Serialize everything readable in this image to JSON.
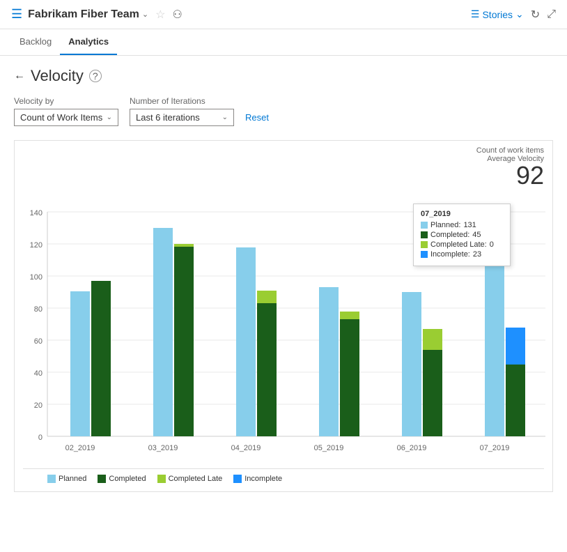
{
  "header": {
    "icon": "☰",
    "team_name": "Fabrikam Fiber Team",
    "chevron": "⌄",
    "star": "☆",
    "people": "⚇",
    "stories_label": "Stories",
    "stories_chevron": "⌄",
    "refresh": "↻",
    "expand": "⤢"
  },
  "tabs": [
    {
      "label": "Backlog",
      "active": false
    },
    {
      "label": "Analytics",
      "active": true
    }
  ],
  "page": {
    "back": "←",
    "title": "Velocity",
    "help": "?"
  },
  "filters": {
    "velocity_by_label": "Velocity by",
    "velocity_by_value": "Count of Work Items",
    "velocity_by_chevron": "⌄",
    "iterations_label": "Number of Iterations",
    "iterations_value": "Last 6 iterations",
    "iterations_chevron": "⌄",
    "reset_label": "Reset"
  },
  "chart": {
    "meta_label1": "Count of work items",
    "meta_label2": "Average Velocity",
    "meta_value": "92",
    "y_labels": [
      "0",
      "20",
      "40",
      "60",
      "80",
      "100",
      "120",
      "140"
    ],
    "x_labels": [
      "02_2019",
      "03_2019",
      "04_2019",
      "05_2019",
      "06_2019",
      "07_2019"
    ],
    "bars": [
      {
        "sprint": "02_2019",
        "planned": 90,
        "completed": 97,
        "completed_late": 0,
        "incomplete": 0
      },
      {
        "sprint": "03_2019",
        "planned": 130,
        "completed": 119,
        "completed_late": 0,
        "incomplete": 0
      },
      {
        "sprint": "04_2019",
        "planned": 118,
        "completed": 83,
        "completed_late": 8,
        "incomplete": 0
      },
      {
        "sprint": "05_2019",
        "planned": 93,
        "completed": 73,
        "completed_late": 5,
        "incomplete": 0
      },
      {
        "sprint": "06_2019",
        "planned": 90,
        "completed": 54,
        "completed_late": 13,
        "incomplete": 0
      },
      {
        "sprint": "07_2019",
        "planned": 131,
        "completed": 45,
        "completed_late": 0,
        "incomplete": 23
      }
    ],
    "tooltip": {
      "sprint": "07_2019",
      "planned_label": "Planned:",
      "planned_value": "131",
      "completed_label": "Completed:",
      "completed_value": "45",
      "completed_late_label": "Completed Late:",
      "completed_late_value": "0",
      "incomplete_label": "Incomplete:",
      "incomplete_value": "23"
    },
    "colors": {
      "planned": "#87ceeb",
      "completed": "#1a5e1a",
      "completed_late": "#9acd32",
      "incomplete": "#1e90ff"
    }
  },
  "legend": {
    "items": [
      {
        "label": "Planned",
        "color": "#87ceeb"
      },
      {
        "label": "Completed",
        "color": "#1a5e1a"
      },
      {
        "label": "Completed Late",
        "color": "#9acd32"
      },
      {
        "label": "Incomplete",
        "color": "#1e90ff"
      }
    ]
  }
}
